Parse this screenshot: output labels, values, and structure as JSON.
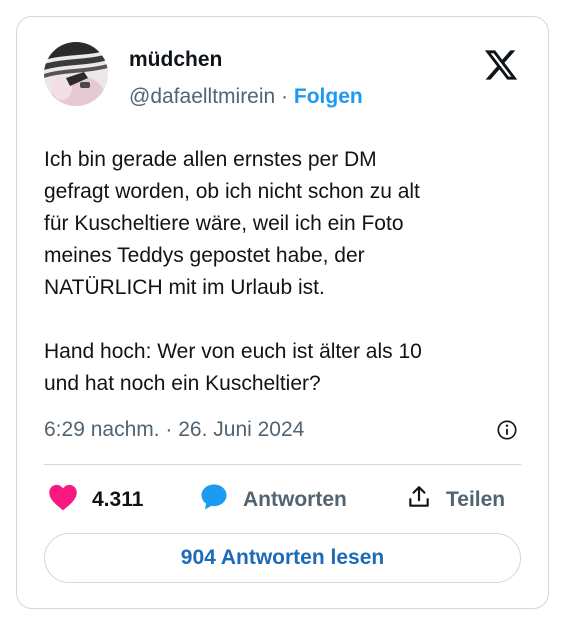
{
  "author": {
    "display_name": "müdchen",
    "handle": "@dafaelltmirein",
    "separator": "·",
    "follow_label": "Folgen"
  },
  "tweet": {
    "paragraph_1": "Ich bin gerade allen ernstes per DM\ngefragt worden, ob ich nicht schon zu alt\nfür Kuscheltiere wäre, weil ich ein Foto\nmeines Teddys gepostet habe, der\nNATÜRLICH mit im Urlaub ist.",
    "paragraph_2": "Hand hoch: Wer von euch ist älter als 10\nund hat noch ein Kuscheltier?",
    "timestamp": "6:29 nachm. · 26. Juni 2024"
  },
  "actions": {
    "like_count": "4.311",
    "reply_label": "Antworten",
    "share_label": "Teilen",
    "read_replies_label": "904 Antworten lesen"
  },
  "icons": {
    "logo": "x-logo-icon",
    "info": "info-icon",
    "like": "heart-icon",
    "reply": "speech-bubble-icon",
    "share": "share-icon"
  },
  "colors": {
    "like": "#f91880",
    "reply_icon": "#1d9bf0",
    "follow_link": "#1d9bf0",
    "read_replies_text": "#1d6ab8",
    "secondary_text": "#536471",
    "border": "#cfd9de"
  }
}
